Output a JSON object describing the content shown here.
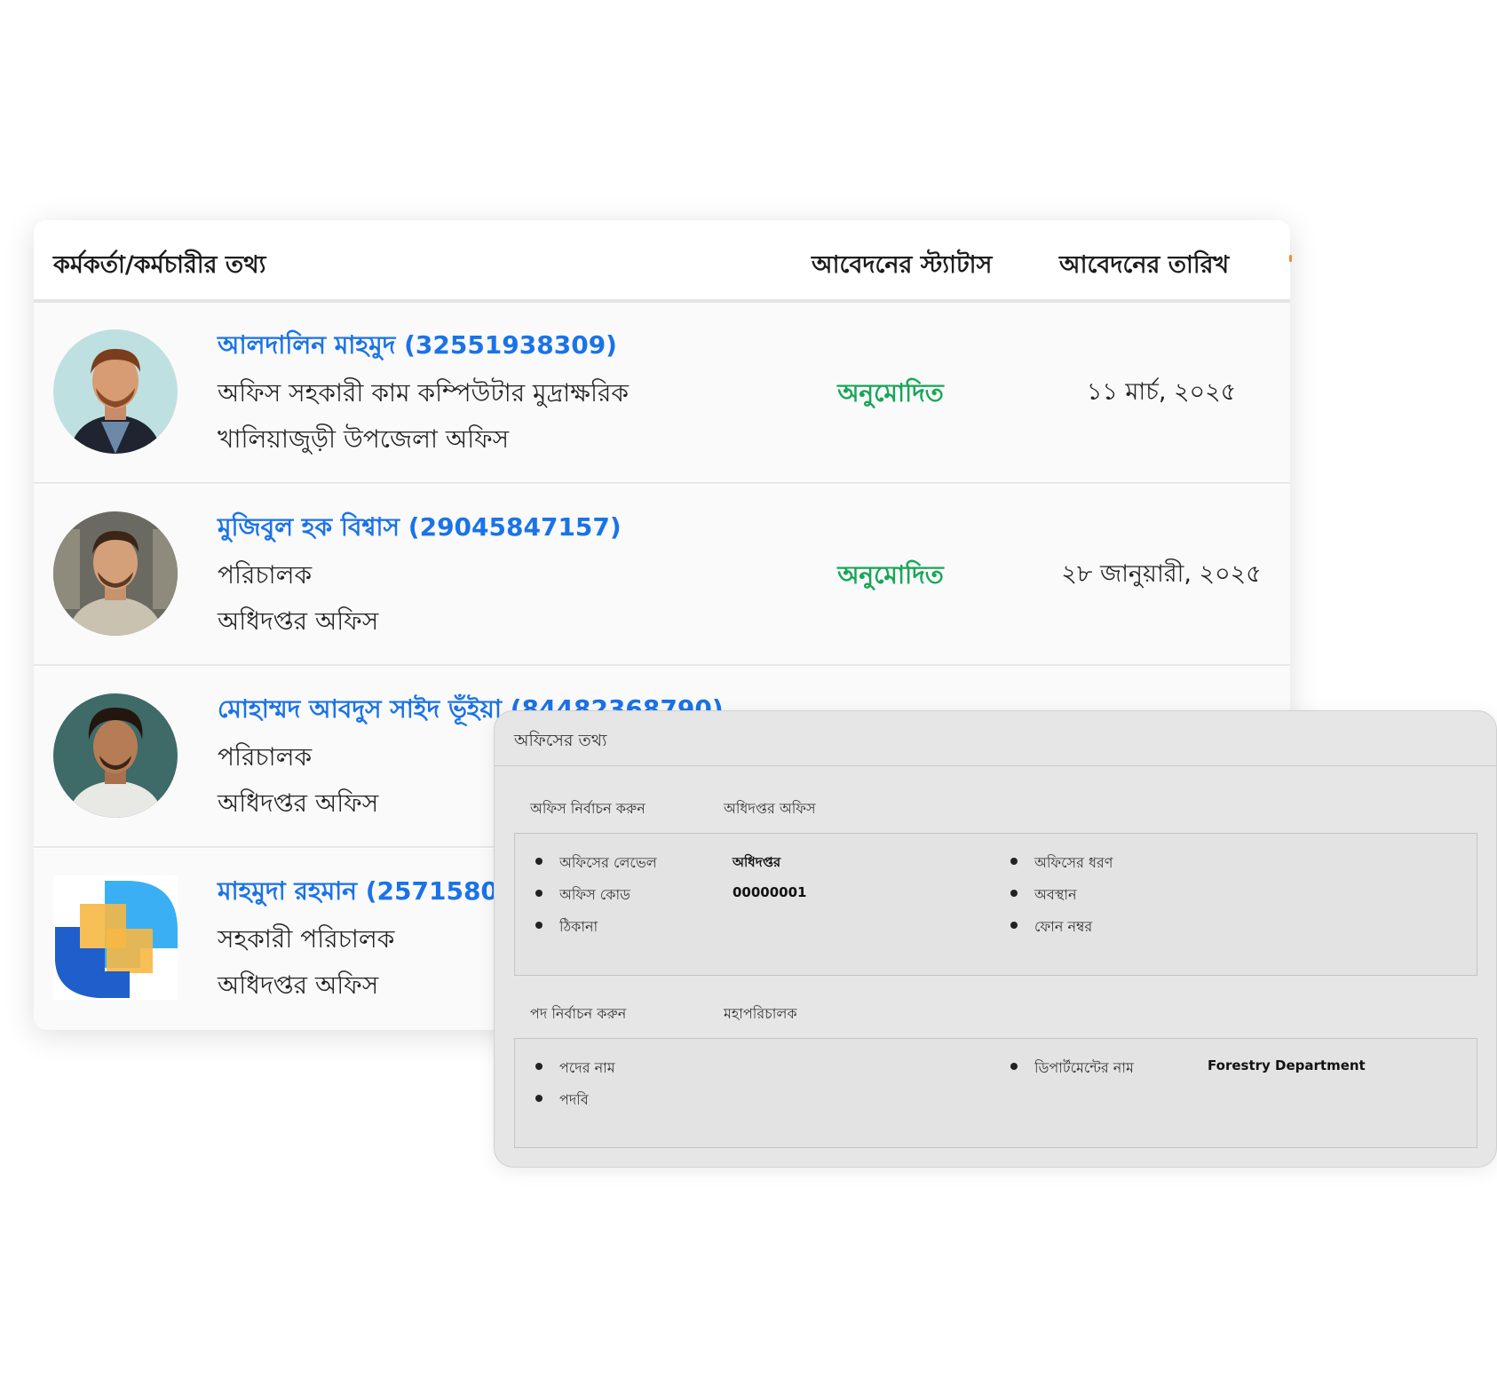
{
  "table": {
    "headers": {
      "info": "কর্মকর্তা/কর্মচারীর তথ্য",
      "status": "আবেদনের স্ট্যাটাস",
      "date": "আবেদনের তারিখ"
    },
    "rows": [
      {
        "name": "আলদালিন মাহমুদ (32551938309)",
        "role": "অফিস সহকারী কাম কম্পিউটার মুদ্রাক্ষরিক",
        "office": "খালিয়াজুড়ী উপজেলা অফিস",
        "status": "অনুমোদিত",
        "date": "১১ মার্চ, ২০২৫"
      },
      {
        "name": "মুজিবুল হক বিশ্বাস (29045847157)",
        "role": "পরিচালক",
        "office": "অধিদপ্তর অফিস",
        "status": "অনুমোদিত",
        "date": "২৮ জানুয়ারী, ২০২৫"
      },
      {
        "name": "মোহাম্মদ আবদুস সাইদ ভূঁইয়া (84482368790)",
        "role": "পরিচালক",
        "office": "অধিদপ্তর অফিস",
        "status": "",
        "date": ""
      },
      {
        "name": "মাহমুদা রহমান (25715805",
        "role": "সহকারী পরিচালক",
        "office": "অধিদপ্তর অফিস",
        "status": "",
        "date": ""
      }
    ],
    "status_color": "#18a558",
    "name_color": "#1a73e8"
  },
  "office_panel": {
    "title": "অফিসের তথ্য",
    "office_select": {
      "label": "অফিস নির্বাচন করুন",
      "value": "অধিদপ্তর অফিস"
    },
    "office_details": {
      "level_label": "অফিসের লেভেল",
      "level_value": "অধিদপ্তর",
      "code_label": "অফিস কোড",
      "code_value": "00000001",
      "address_label": "ঠিকানা",
      "type_label": "অফিসের ধরণ",
      "location_label": "অবস্থান",
      "phone_label": "ফোন নম্বর"
    },
    "post_select": {
      "label": "পদ নির্বাচন করুন",
      "value": "মহাপরিচালক"
    },
    "post_details": {
      "post_name_label": "পদের নাম",
      "designation_label": "পদবি",
      "department_label": "ডিপার্টমেন্টের নাম",
      "department_value": "Forestry Department"
    }
  }
}
